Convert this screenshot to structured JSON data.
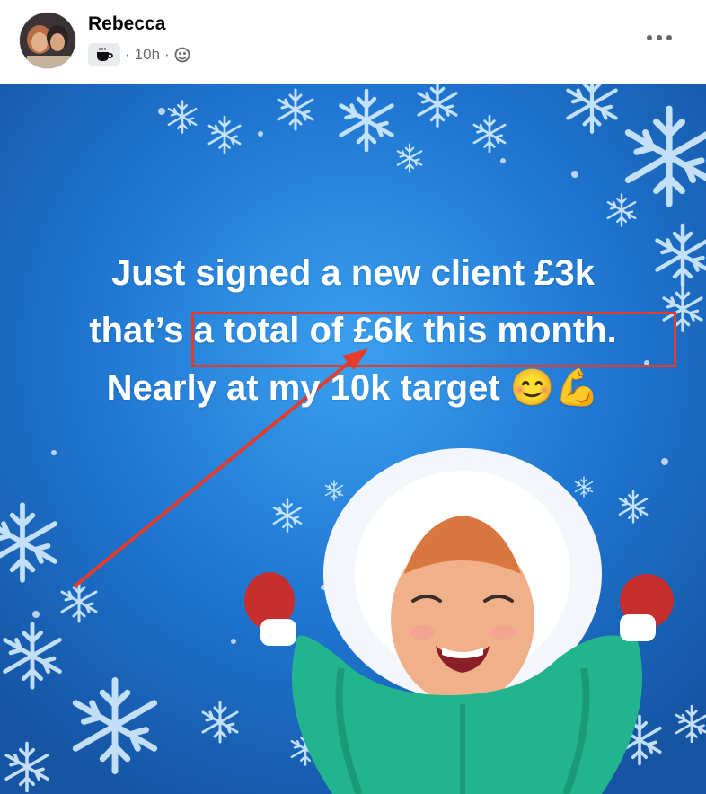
{
  "post": {
    "author": "Rebecca",
    "time": "10h",
    "separator": "·",
    "audience_icon": "public-globe-icon",
    "badge_icon": "coffee-cup-icon",
    "more_icon": "more-options-icon"
  },
  "image": {
    "lines": [
      "Just signed a new client £3k",
      "that’s a total of £6k this month.",
      "Nearly at my 10k target 😊💪"
    ],
    "annotation_color": "#e53b2a",
    "background_color": "#1f6fca"
  }
}
